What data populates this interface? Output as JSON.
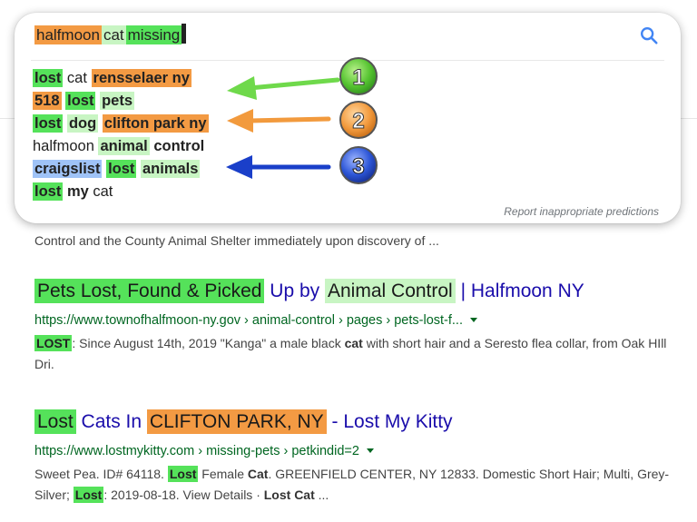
{
  "search": {
    "query_parts": [
      "halfmoon",
      "cat",
      "missing"
    ],
    "suggestions": [
      {
        "segments": [
          {
            "text": "lost",
            "style": "g",
            "bold": true
          },
          {
            "text": " cat ",
            "style": "",
            "bold": false
          },
          {
            "text": "rensselaer ny",
            "style": "o",
            "bold": true
          }
        ]
      },
      {
        "segments": [
          {
            "text": "518",
            "style": "o",
            "bold": true
          },
          {
            "text": " ",
            "style": "",
            "bold": false
          },
          {
            "text": "lost",
            "style": "g",
            "bold": true
          },
          {
            "text": " ",
            "style": "",
            "bold": false
          },
          {
            "text": "pets",
            "style": "lg",
            "bold": true
          }
        ]
      },
      {
        "segments": [
          {
            "text": "lost",
            "style": "g",
            "bold": true
          },
          {
            "text": " ",
            "style": "",
            "bold": false
          },
          {
            "text": "dog",
            "style": "lg",
            "bold": true
          },
          {
            "text": " ",
            "style": "",
            "bold": false
          },
          {
            "text": "clifton park ny",
            "style": "o",
            "bold": true
          }
        ]
      },
      {
        "segments": [
          {
            "text": "halfmoon ",
            "style": "",
            "bold": false
          },
          {
            "text": "animal",
            "style": "lg",
            "bold": true
          },
          {
            "text": " ",
            "style": "",
            "bold": false
          },
          {
            "text": "control",
            "style": "",
            "bold": true
          }
        ]
      },
      {
        "segments": [
          {
            "text": "craigslist",
            "style": "b",
            "bold": true
          },
          {
            "text": " ",
            "style": "",
            "bold": false
          },
          {
            "text": "lost",
            "style": "g",
            "bold": true
          },
          {
            "text": " ",
            "style": "",
            "bold": false
          },
          {
            "text": "animals",
            "style": "lg",
            "bold": true
          }
        ]
      },
      {
        "segments": [
          {
            "text": "lost",
            "style": "g",
            "bold": true
          },
          {
            "text": " ",
            "style": "",
            "bold": false
          },
          {
            "text": "my",
            "style": "",
            "bold": true
          },
          {
            "text": " cat",
            "style": "",
            "bold": false
          }
        ]
      }
    ],
    "report_link": "Report inappropriate predictions"
  },
  "annotations": {
    "badge1": "1",
    "badge2": "2",
    "badge3": "3",
    "colors": {
      "green": "#5fcf45",
      "orange": "#f29a3d",
      "blue": "#1a3fc9"
    }
  },
  "snippet_top": "Control and the County Animal Shelter immediately upon discovery of ...",
  "results": [
    {
      "title_hl1": "Pets Lost, Found & Picked",
      "title_mid": " Up by ",
      "title_hl2": "Animal Control",
      "title_end": " | Halfmoon NY",
      "url": "https://www.townofhalfmoon-ny.gov › animal-control › pages › pets-lost-f...",
      "snippet_hl": "LOST",
      "snippet_a": ": Since August 14th, 2019 \"Kanga\" a male black ",
      "snippet_b": "cat",
      "snippet_c": " with short hair and a Seresto flea collar, from Oak HIll Dri."
    },
    {
      "title_hl1": "Lost",
      "title_mid": " Cats In ",
      "title_hl2": "CLIFTON PARK, NY",
      "title_end": " - Lost My Kitty",
      "url": "https://www.lostmykitty.com › missing-pets › petkindid=2",
      "snippet_a": "Sweet Pea. ID# 64118. ",
      "snippet_hl1": "Lost",
      "snippet_b": " Female ",
      "snippet_bold1": "Cat",
      "snippet_c": ". GREENFIELD CENTER, NY 12833. Domestic Short Hair; Multi, Grey-Silver; ",
      "snippet_hl2": "Lost",
      "snippet_d": ": 2019-08-18. View Details · ",
      "snippet_bold2": "Lost Cat",
      "snippet_e": " ..."
    }
  ]
}
